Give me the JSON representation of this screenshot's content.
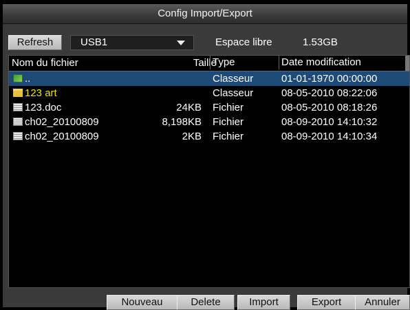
{
  "window": {
    "title": "Config Import/Export"
  },
  "toolbar": {
    "refresh_label": "Refresh",
    "device_selected": "USB1",
    "free_space_label": "Espace libre",
    "free_space_value": "1.53GB"
  },
  "table": {
    "columns": [
      "Nom du fichier",
      "Taille",
      "Type",
      "Date modification"
    ],
    "rows": [
      {
        "icon": "parent-folder-icon",
        "name": "..",
        "size": "",
        "type": "Classeur",
        "date": "01-01-1970 00:00:00"
      },
      {
        "icon": "folder-icon",
        "name": "123 art",
        "size": "",
        "type": "Classeur",
        "date": "08-05-2010 08:22:06"
      },
      {
        "icon": "document-icon",
        "name": "123.doc",
        "size": "24KB",
        "type": "Fichier",
        "date": "08-05-2010 08:18:26"
      },
      {
        "icon": "document-icon",
        "name": "ch02_20100809",
        "size": "8,198KB",
        "type": "Fichier",
        "date": "08-09-2010 14:10:32"
      },
      {
        "icon": "document-icon",
        "name": "ch02_20100809",
        "size": "2KB",
        "type": "Fichier",
        "date": "08-09-2010 14:10:34"
      }
    ]
  },
  "footer": {
    "new_label": "Nouveau",
    "delete_label": "Delete",
    "import_label": "Import",
    "export_label": "Export",
    "cancel_label": "Annuler"
  },
  "colors": {
    "selected_row": "#1e4a78",
    "folder_text": "#f0e000",
    "panel": "#3a3a3a"
  }
}
